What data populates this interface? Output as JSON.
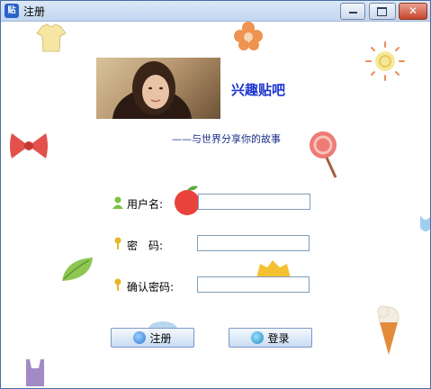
{
  "window": {
    "title": "注册",
    "app_icon_text": "贴"
  },
  "header": {
    "app_title": "兴趣贴吧",
    "subtitle": "——与世界分享你的故事"
  },
  "form": {
    "username_label": "用户名:",
    "password_label": "密　码:",
    "confirm_label": "确认密码:",
    "username_value": "",
    "password_value": "",
    "confirm_value": ""
  },
  "buttons": {
    "register_label": "注册",
    "login_label": "登录"
  },
  "colors": {
    "title_blue": "#1a33d0",
    "subtitle_blue": "#1c2d88"
  }
}
